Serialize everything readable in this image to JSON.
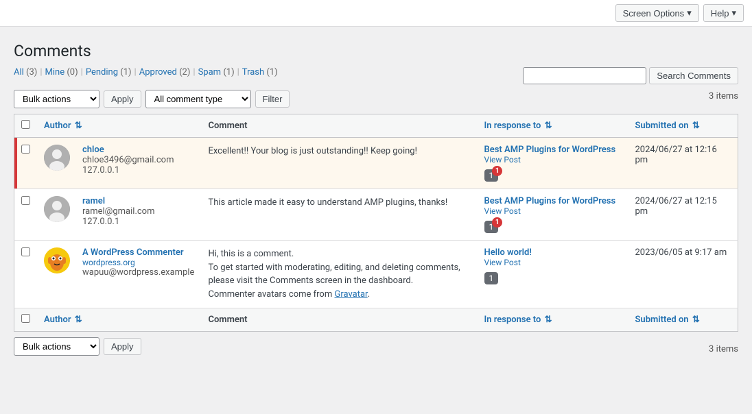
{
  "topbar": {
    "screen_options_label": "Screen Options",
    "help_label": "Help"
  },
  "page": {
    "title": "Comments"
  },
  "filter_links": [
    {
      "label": "All",
      "count": "(3)",
      "href": "#"
    },
    {
      "label": "Mine",
      "count": "(0)",
      "href": "#"
    },
    {
      "label": "Pending",
      "count": "(1)",
      "href": "#"
    },
    {
      "label": "Approved",
      "count": "(2)",
      "href": "#"
    },
    {
      "label": "Spam",
      "count": "(1)",
      "href": "#"
    },
    {
      "label": "Trash",
      "count": "(1)",
      "href": "#"
    }
  ],
  "toolbar": {
    "bulk_actions_label": "Bulk actions",
    "apply_label": "Apply",
    "comment_type_label": "All comment type",
    "filter_label": "Filter",
    "items_count": "3 items",
    "search_placeholder": "",
    "search_btn_label": "Search Comments"
  },
  "table": {
    "col_author": "Author",
    "col_comment": "Comment",
    "col_response": "In response to",
    "col_submitted": "Submitted on",
    "rows": [
      {
        "id": 1,
        "pending": true,
        "author_name": "chloe",
        "author_email": "chloe3496@gmail.com",
        "author_ip": "127.0.0.1",
        "avatar_type": "person",
        "comment": "Excellent!! Your blog is just outstanding!! Keep going!",
        "response_title": "Best AMP Plugins for WordPress",
        "response_link": "#",
        "view_post_label": "View Post",
        "bubble_count": "1",
        "has_badge": true,
        "badge_count": "1",
        "submitted": "2024/06/27 at 12:16 pm"
      },
      {
        "id": 2,
        "pending": false,
        "author_name": "ramel",
        "author_email": "ramel@gmail.com",
        "author_ip": "127.0.0.1",
        "avatar_type": "person",
        "comment": "This article made it easy to understand AMP plugins, thanks!",
        "response_title": "Best AMP Plugins for WordPress",
        "response_link": "#",
        "view_post_label": "View Post",
        "bubble_count": "1",
        "has_badge": true,
        "badge_count": "1",
        "submitted": "2024/06/27 at 12:15 pm"
      },
      {
        "id": 3,
        "pending": false,
        "author_name": "A WordPress Commenter",
        "author_email": "wordpress.org",
        "author_ip2": "wapuu@wordpress.example",
        "avatar_type": "wapuu",
        "comment_parts": [
          "Hi, this is a comment.",
          "To get started with moderating, editing, and deleting comments, please visit the Comments screen in the dashboard.",
          "Commenter avatars come from"
        ],
        "gravatar_link_label": "Gravatar",
        "gravatar_link": "#",
        "response_title": "Hello world!",
        "response_link": "#",
        "view_post_label": "View Post",
        "bubble_count": "1",
        "has_badge": false,
        "submitted": "2023/06/05 at 9:17 am"
      }
    ]
  },
  "bottom_toolbar": {
    "bulk_actions_label": "Bulk actions",
    "apply_label": "Apply",
    "items_count": "3 items"
  }
}
